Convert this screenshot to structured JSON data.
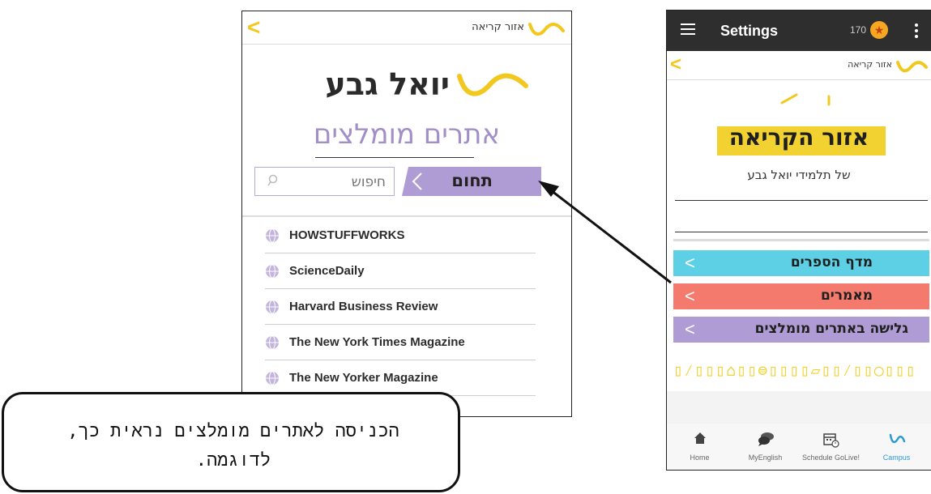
{
  "left_screen": {
    "header_label": "אזור קריאה",
    "brand_title": "יואל גבע",
    "page_title": "אתרים מומלצים",
    "search_placeholder": "חיפוש",
    "field_label": "תחום",
    "sites": [
      "HOWSTUFFWORKS",
      "ScienceDaily",
      "Harvard Business Review",
      "The New York Times Magazine",
      "The New Yorker Magazine"
    ]
  },
  "right_screen": {
    "app_title": "Settings",
    "coin_count": "170",
    "header_label": "אזור קריאה",
    "banner_title": "אזור הקריאה",
    "banner_subtitle": "של תלמידי יואל גבע",
    "menu": [
      {
        "label": "מדף הספרים",
        "color": "#5dd0e6"
      },
      {
        "label": "מאמרים",
        "color": "#f47a6e"
      },
      {
        "label": "גלישה באתרים מומלצים",
        "color": "#b09cd4"
      }
    ],
    "nav": [
      {
        "label": "Home",
        "icon": "home-icon"
      },
      {
        "label": "MyEnglish",
        "icon": "chat-icon"
      },
      {
        "label": "Schedule GoLive!",
        "icon": "calendar-icon"
      },
      {
        "label": "Campus",
        "icon": "campus-icon",
        "active": true
      }
    ]
  },
  "callout_text": "הכניסה לאתרים מומלצים נראית כך, לדוגמה.",
  "colors": {
    "accent_yellow": "#f2c81e",
    "purple": "#b09cd4",
    "campus_blue": "#2b9bd6"
  }
}
